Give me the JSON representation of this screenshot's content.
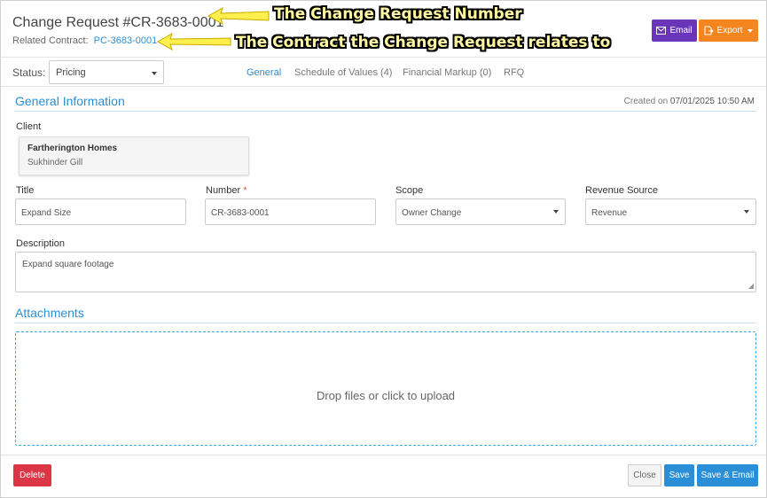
{
  "header": {
    "title": "Change Request #CR-3683-0001",
    "related_label": "Related Contract:",
    "related_link": "PC-3683-0001",
    "email_button": "Email",
    "export_button": "Export"
  },
  "annotations": {
    "note_1": "The Change Request Number",
    "note_2": "The Contract the Change Request relates to",
    "color": "#fff7a0"
  },
  "status": {
    "label": "Status:",
    "value": "Pricing"
  },
  "tabs": [
    {
      "label": "General",
      "active": true
    },
    {
      "label": "Schedule of Values (4)",
      "active": false
    },
    {
      "label": "Financial Markup (0)",
      "active": false
    },
    {
      "label": "RFQ",
      "active": false
    }
  ],
  "general": {
    "title": "General Information",
    "created_prefix": "Created on",
    "created_date": "07/01/2025 10:50 AM",
    "client_label": "Client",
    "client_name": "Fartherington Homes",
    "client_contact": "Sukhinder Gill",
    "title_label": "Title",
    "title_value": "Expand Size",
    "number_label": "Number",
    "number_required": "*",
    "number_value": "CR-3683-0001",
    "scope_label": "Scope",
    "scope_value": "Owner Change",
    "revenue_label": "Revenue Source",
    "revenue_value": "Revenue",
    "description_label": "Description",
    "description_value": "Expand square footage"
  },
  "attachments": {
    "title": "Attachments",
    "dropzone_text": "Drop files or click to upload"
  },
  "footer": {
    "delete_button": "Delete",
    "close_button": "Close",
    "save_button": "Save",
    "save_email_button": "Save & Email"
  },
  "colors": {
    "accent": "#2a8fd6",
    "email": "#6a35b8",
    "export": "#f5861f",
    "danger": "#dc3545"
  },
  "icons": {
    "email": "envelope-icon",
    "export": "export-file-icon",
    "arrow": "yellow-arrow-icon"
  }
}
